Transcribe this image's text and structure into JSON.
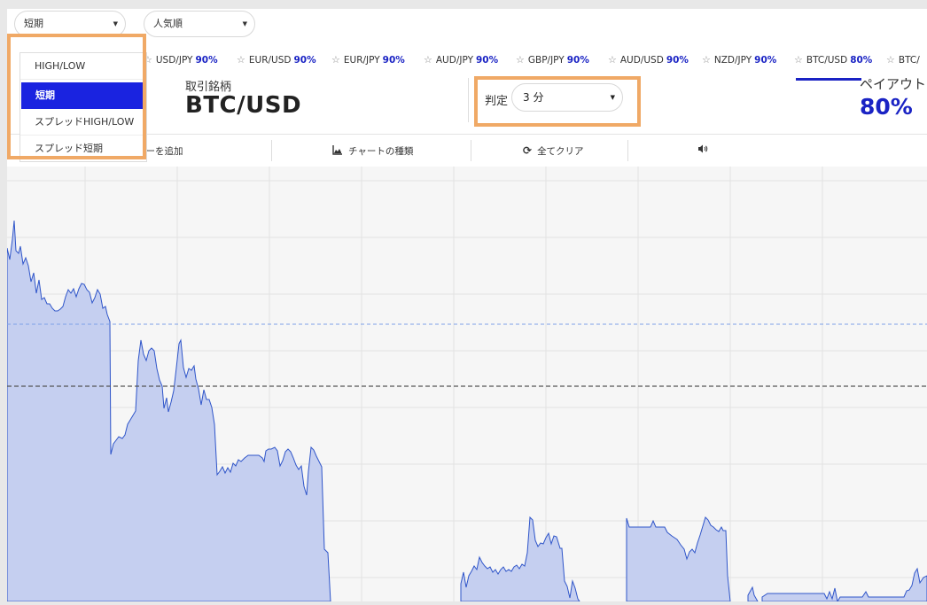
{
  "period_select": {
    "value": "短期"
  },
  "sort_select": {
    "value": "人気順"
  },
  "product_menu": {
    "items": [
      {
        "label": "HIGH/LOW"
      },
      {
        "label": "短期"
      },
      {
        "label": "スプレッドHIGH/LOW"
      },
      {
        "label": "スプレッド短期"
      }
    ],
    "selected": "短期"
  },
  "symbols": [
    {
      "pair": "USD/JPY",
      "pct": "90%"
    },
    {
      "pair": "EUR/USD",
      "pct": "90%"
    },
    {
      "pair": "EUR/JPY",
      "pct": "90%"
    },
    {
      "pair": "AUD/JPY",
      "pct": "90%"
    },
    {
      "pair": "GBP/JPY",
      "pct": "90%"
    },
    {
      "pair": "AUD/USD",
      "pct": "90%"
    },
    {
      "pair": "NZD/JPY",
      "pct": "90%"
    },
    {
      "pair": "BTC/USD",
      "pct": "80%"
    },
    {
      "pair": "BTC/",
      "pct": ""
    }
  ],
  "asset": {
    "label": "取引銘柄",
    "value": "BTC/USD"
  },
  "judgement": {
    "label": "判定",
    "value": "3 分"
  },
  "payout": {
    "label": "ペイアウト",
    "value": "80%"
  },
  "toolbar": {
    "indicator_label": "ターを追加",
    "chart_type_label": "チャートの種類",
    "clear_label": "全てクリア"
  },
  "icons": {
    "chart_type": "area-chart-icon",
    "clear": "refresh-icon",
    "sound": "speaker-icon",
    "star": "star-outline-icon"
  },
  "colors": {
    "accent": "#1a23c4",
    "menu_active": "#1a23e0",
    "highlight": "#f0a966",
    "chart_fill": "#c5cff0",
    "chart_line": "#2f55c9"
  }
}
